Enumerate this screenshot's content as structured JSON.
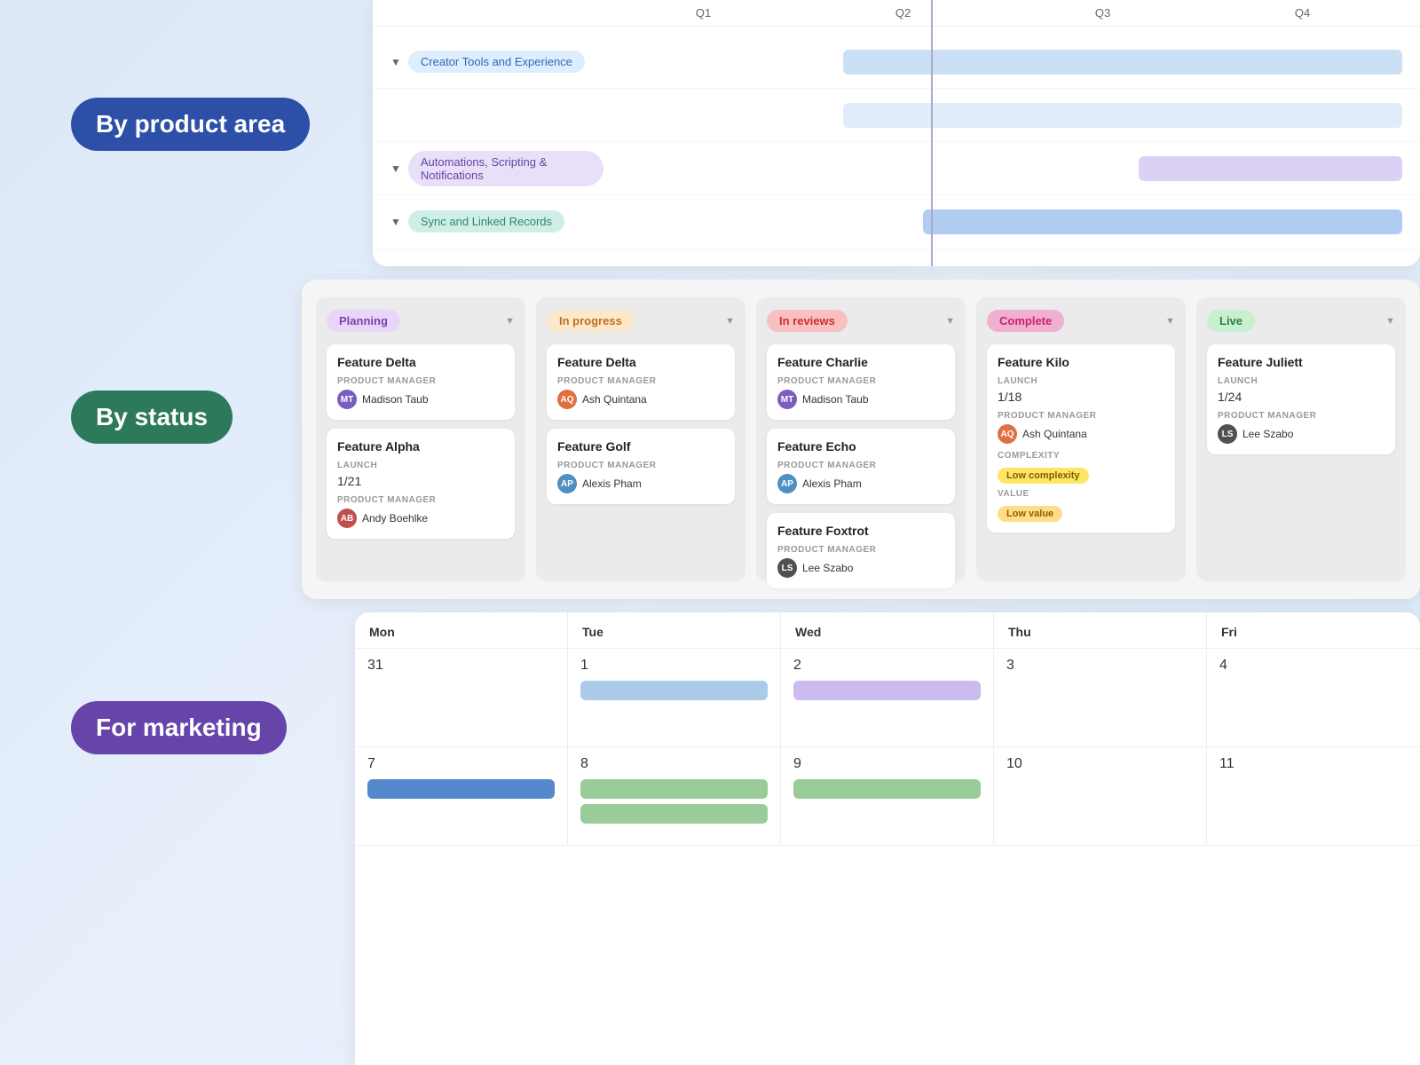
{
  "labels": {
    "by_product_area": "By product area",
    "by_status": "By status",
    "for_marketing": "For marketing"
  },
  "gantt": {
    "quarters": [
      "Q1",
      "Q2",
      "Q3",
      "Q4"
    ],
    "rows": [
      {
        "label": "Creator Tools and Experience",
        "tag_color": "blue"
      },
      {
        "label": "Automations, Scripting & Notifications",
        "tag_color": "purple"
      },
      {
        "label": "Sync and Linked Records",
        "tag_color": "teal"
      }
    ]
  },
  "kanban": {
    "columns": [
      {
        "status": "Planning",
        "badge": "planning",
        "cards": [
          {
            "title": "Feature Delta",
            "label": "PRODUCT MANAGER",
            "person": "Madison Taub",
            "avatar_class": "av-madison",
            "avatar_initials": "MT",
            "launch": null
          },
          {
            "title": "Feature Alpha",
            "label_launch": "LAUNCH",
            "launch": "1/21",
            "label_pm": "PRODUCT MANAGER",
            "person": "Andy Boehlke",
            "avatar_class": "av-andy",
            "avatar_initials": "AB"
          }
        ]
      },
      {
        "status": "In progress",
        "badge": "inprogress",
        "cards": [
          {
            "title": "Feature Delta",
            "label": "PRODUCT MANAGER",
            "person": "Ash Quintana",
            "avatar_class": "av-ash",
            "avatar_initials": "AQ"
          },
          {
            "title": "Feature Golf",
            "label": "PRODUCT MANAGER",
            "person": "Alexis Pham",
            "avatar_class": "av-alexis",
            "avatar_initials": "AP"
          }
        ]
      },
      {
        "status": "In reviews",
        "badge": "inreviews",
        "cards": [
          {
            "title": "Feature Charlie",
            "label": "PRODUCT MANAGER",
            "person": "Madison Taub",
            "avatar_class": "av-madison",
            "avatar_initials": "MT"
          },
          {
            "title": "Feature Echo",
            "label": "PRODUCT MANAGER",
            "person": "Alexis Pham",
            "avatar_class": "av-alexis",
            "avatar_initials": "AP"
          },
          {
            "title": "Feature Foxtrot",
            "label": "PRODUCT MANAGER",
            "person": "Lee Szabo",
            "avatar_class": "av-lee",
            "avatar_initials": "LS"
          }
        ]
      },
      {
        "status": "Complete",
        "badge": "complete",
        "cards": [
          {
            "title": "Feature Kilo",
            "launch_label": "LAUNCH",
            "launch": "1/18",
            "pm_label": "PRODUCT MANAGER",
            "person": "Ash Quintana",
            "avatar_class": "av-ash",
            "avatar_initials": "AQ",
            "complexity_label": "COMPLEXITY",
            "complexity": "Low complexity",
            "value_label": "VALUE",
            "value": "Low value"
          }
        ]
      },
      {
        "status": "Live",
        "badge": "live",
        "cards": [
          {
            "title": "Feature Juliett",
            "launch_label": "LAUNCH",
            "launch": "1/24",
            "pm_label": "PRODUCT MANAGER",
            "person": "Lee Szabo",
            "avatar_class": "av-lee",
            "avatar_initials": "LS"
          }
        ]
      }
    ]
  },
  "calendar": {
    "headers": [
      "Mon",
      "Tue",
      "Wed",
      "Thu",
      "Fri"
    ],
    "weeks": [
      {
        "days": [
          {
            "date": "31",
            "bars": []
          },
          {
            "date": "1",
            "bars": [
              "blue"
            ]
          },
          {
            "date": "2",
            "bars": [
              "purple"
            ]
          },
          {
            "date": "3",
            "bars": []
          },
          {
            "date": "4",
            "bars": []
          }
        ]
      },
      {
        "days": [
          {
            "date": "7",
            "bars": [
              "dark-blue"
            ]
          },
          {
            "date": "8",
            "bars": [
              "green",
              "green"
            ]
          },
          {
            "date": "9",
            "bars": [
              "green"
            ]
          },
          {
            "date": "10",
            "bars": []
          },
          {
            "date": "11",
            "bars": []
          }
        ]
      }
    ]
  }
}
